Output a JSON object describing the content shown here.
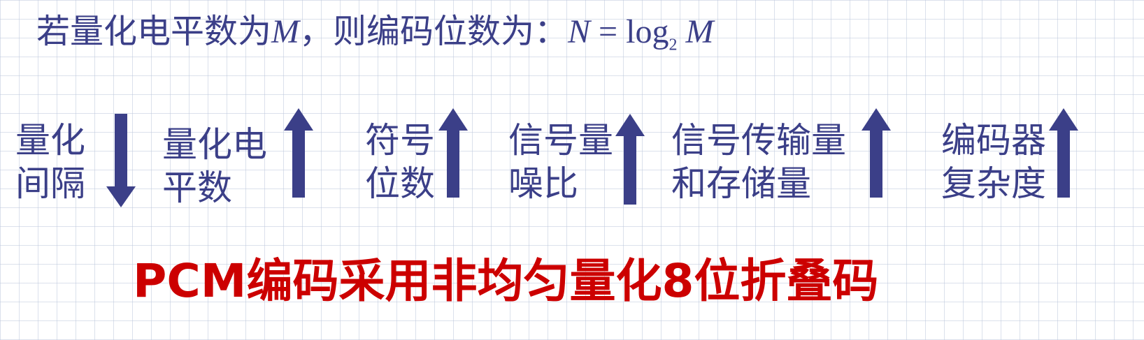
{
  "formula": {
    "prefix": "若量化电平数为",
    "var_m1": "M",
    "middle": "，则编码位数为：",
    "var_n": "N",
    "equals": " = log",
    "subscript": "2",
    "var_m2": " M"
  },
  "relations": [
    {
      "line1": "量化",
      "line2": "间隔",
      "direction": "down"
    },
    {
      "line1": "量化电",
      "line2": "平数",
      "direction": "up"
    },
    {
      "line1": "符号",
      "line2": "位数",
      "direction": "up"
    },
    {
      "line1": "信号量",
      "line2": "噪比",
      "direction": "up"
    },
    {
      "line1": "信号传输量",
      "line2": "和存储量",
      "direction": "up"
    },
    {
      "line1": "编码器",
      "line2": "复杂度",
      "direction": "up"
    }
  ],
  "conclusion": "PCM编码采用非均匀量化8位折叠码",
  "colors": {
    "text": "#3b3f88",
    "arrow": "#3b3f88",
    "conclusion": "#cc0000"
  }
}
